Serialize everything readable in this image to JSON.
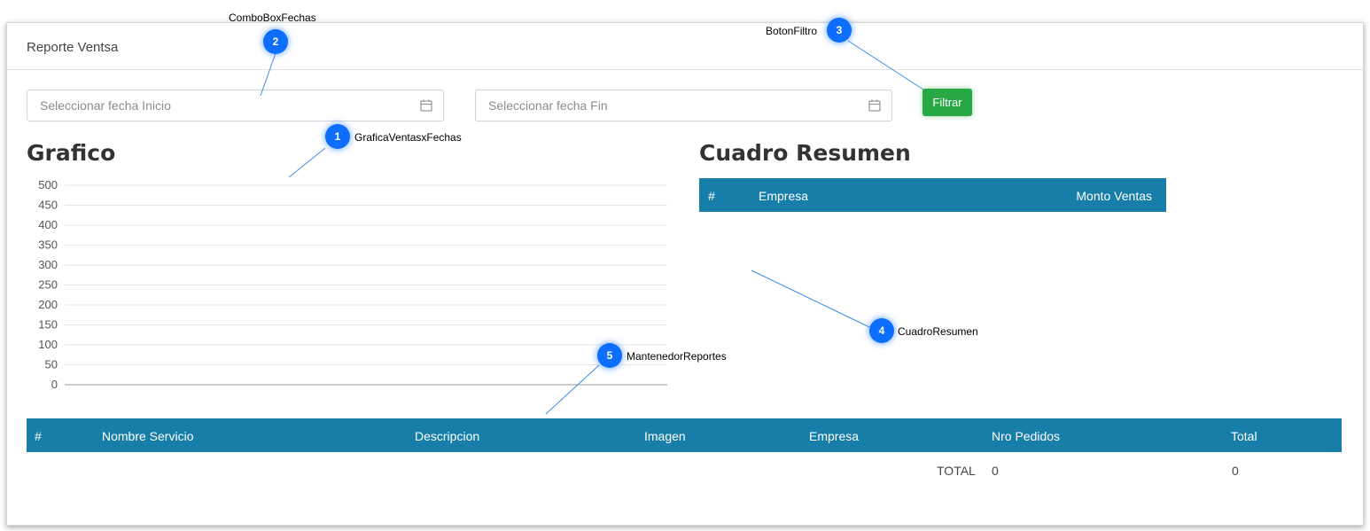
{
  "header": {
    "title": "Reporte Ventsa"
  },
  "filters": {
    "start_placeholder": "Seleccionar fecha Inicio",
    "end_placeholder": "Seleccionar fecha Fin",
    "filter_button": "Filtrar"
  },
  "chart_section": {
    "title": "Grafico"
  },
  "summary_section": {
    "title": "Cuadro Resumen",
    "columns": [
      "#",
      "Empresa",
      "Monto Ventas"
    ]
  },
  "reports_table": {
    "columns": [
      "#",
      "Nombre Servicio",
      "Descripcion",
      "Imagen",
      "Empresa",
      "Nro Pedidos",
      "Total"
    ],
    "total_label": "TOTAL",
    "total_pedidos": "0",
    "total_value": "0"
  },
  "callouts": [
    {
      "number": "1",
      "label": "GraficaVentasxFechas"
    },
    {
      "number": "2",
      "label": "ComboBoxFechas"
    },
    {
      "number": "3",
      "label": "BotonFiltro"
    },
    {
      "number": "4",
      "label": "CuadroResumen"
    },
    {
      "number": "5",
      "label": "MantenedorReportes"
    }
  ],
  "chart_data": {
    "type": "bar",
    "categories": [],
    "values": [],
    "ylim": [
      0,
      500
    ],
    "yticks": [
      0,
      50,
      100,
      150,
      200,
      250,
      300,
      350,
      400,
      450,
      500
    ],
    "grid": true
  },
  "colors": {
    "accent": "#167ea8",
    "filter_button": "#28a745",
    "callout": "#0d6efd"
  },
  "icons": {
    "date_input": "calendar-icon"
  }
}
